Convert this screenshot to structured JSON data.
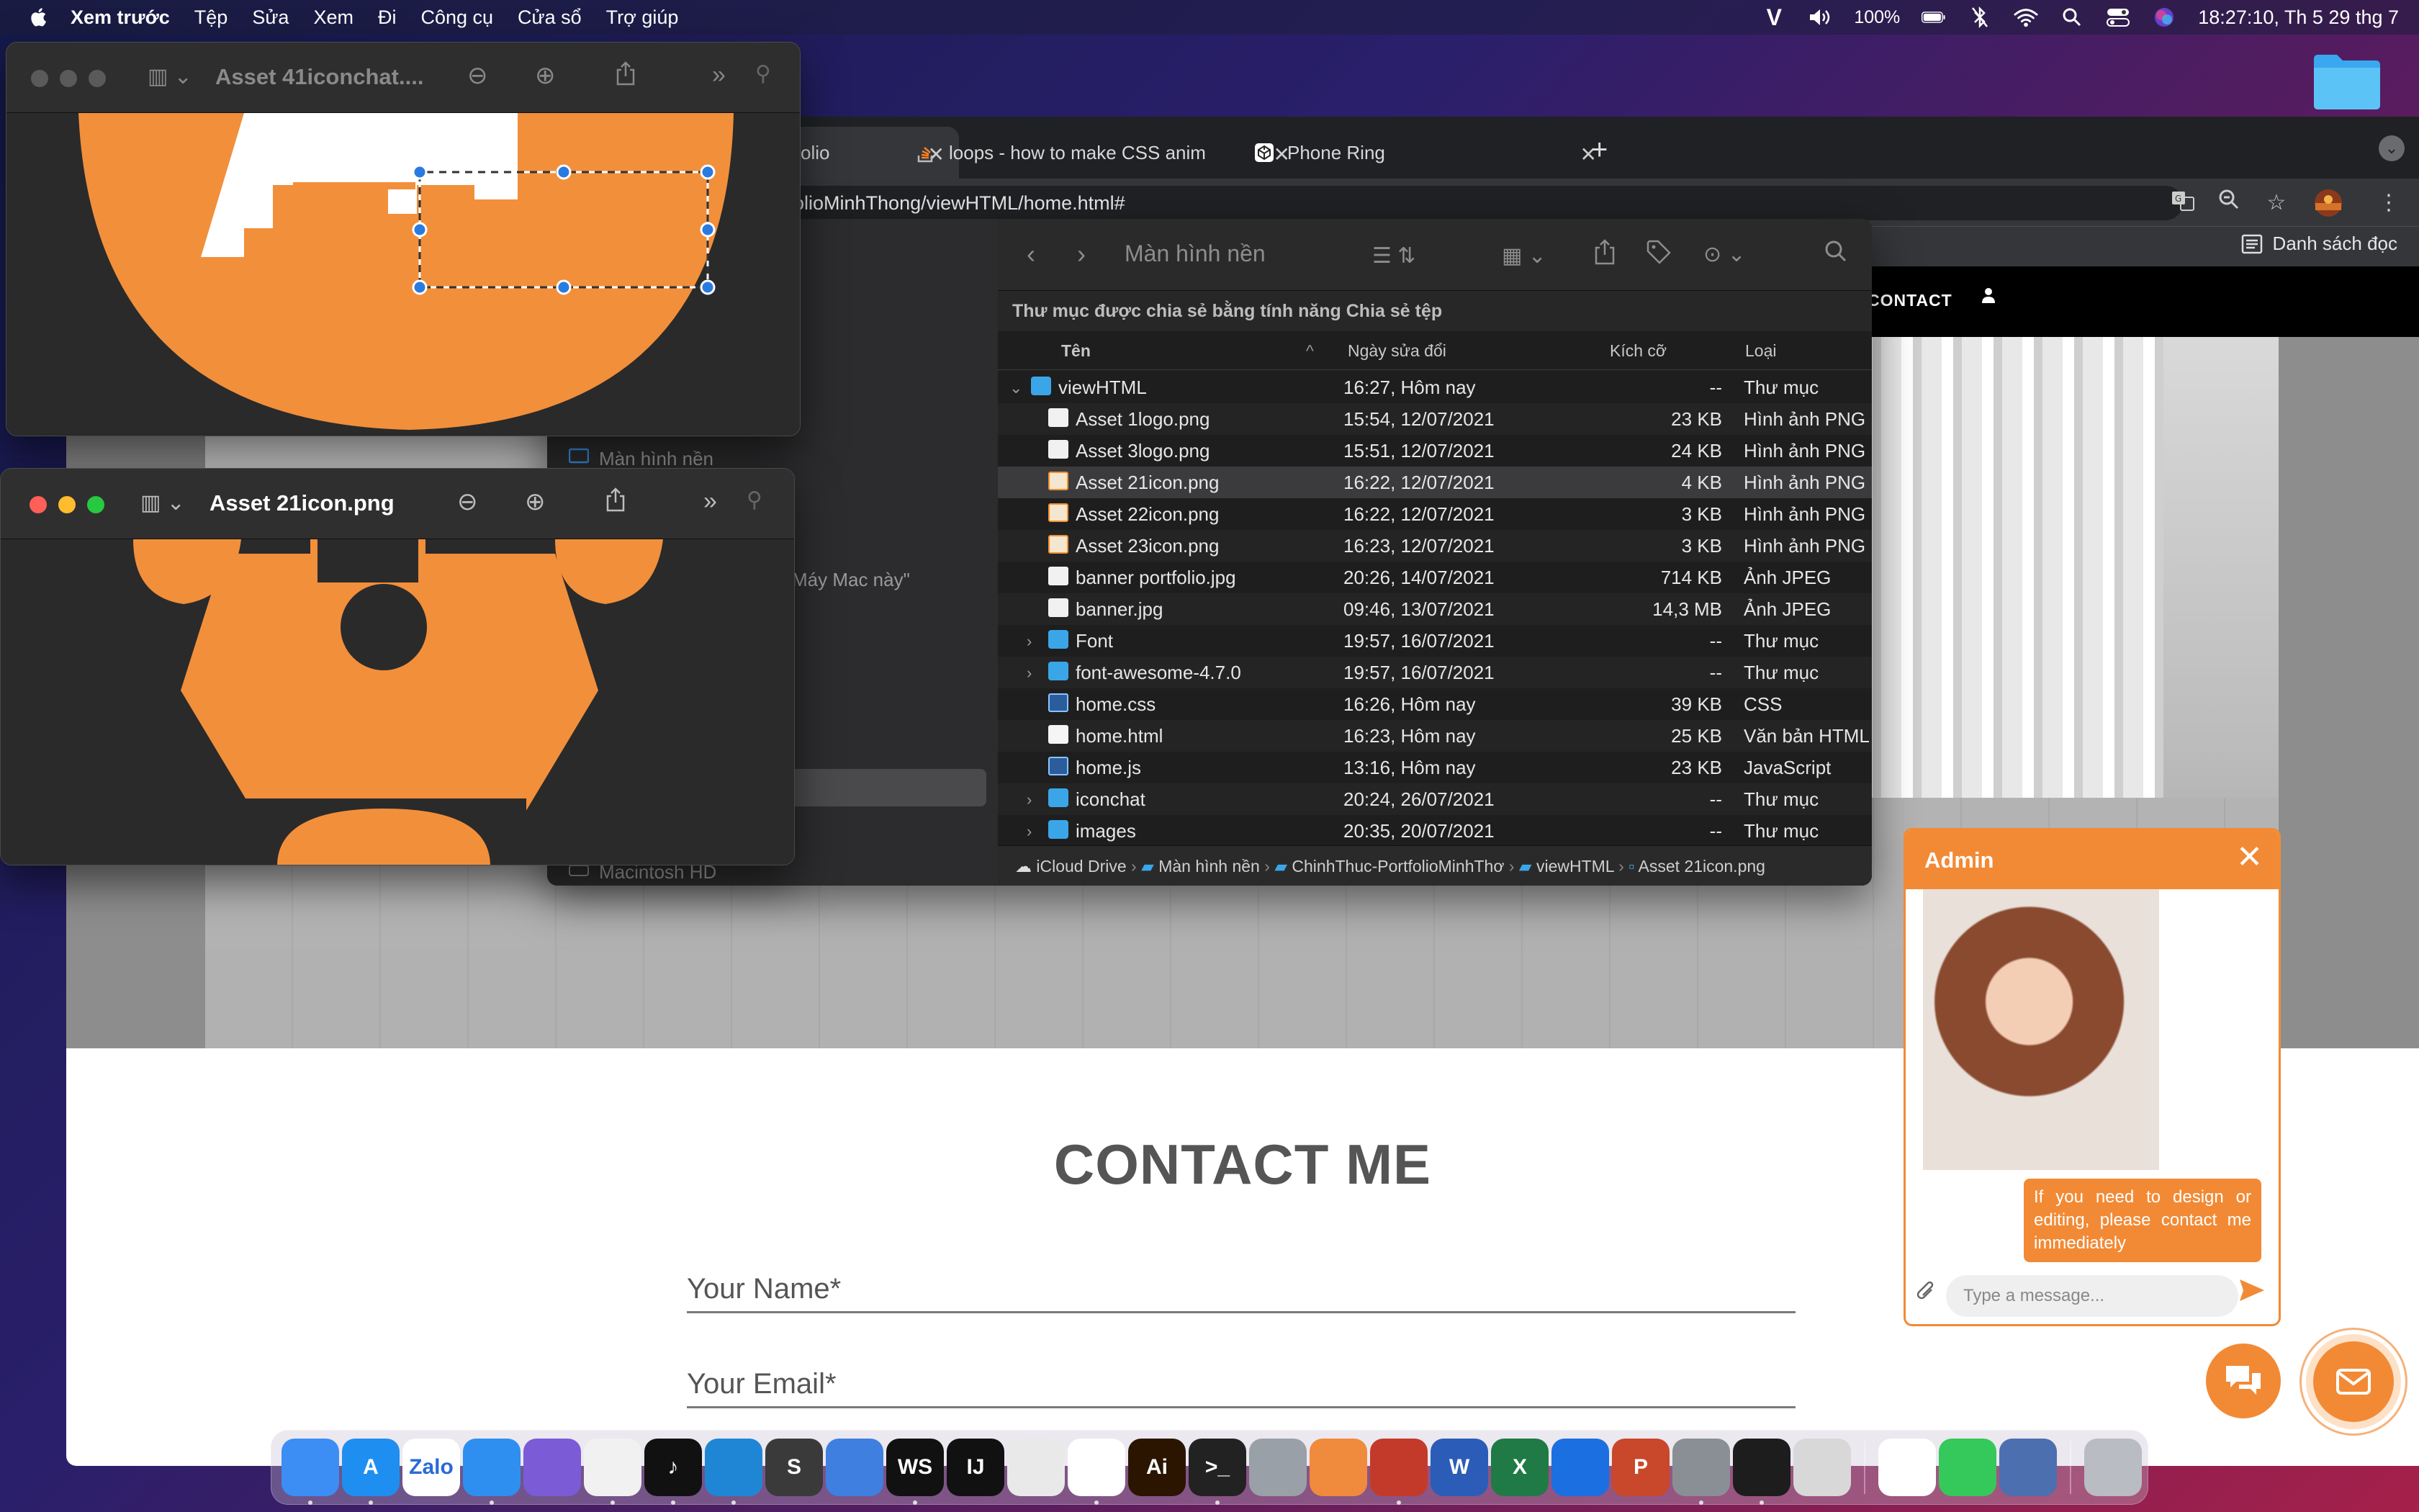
{
  "menubar": {
    "app_name": "Xem trước",
    "items": [
      "Tệp",
      "Sửa",
      "Xem",
      "Đi",
      "Công cụ",
      "Cửa sổ",
      "Trợ giúp"
    ],
    "battery": "100%",
    "clock": "18:27:10, Th 5 29 thg 7"
  },
  "chrome": {
    "tabs": [
      {
        "title": "olio",
        "icon": "portfolio-favicon"
      },
      {
        "title": "loops - how to make CSS anim",
        "icon": "stackoverflow-favicon"
      },
      {
        "title": "Phone Ring",
        "icon": "codepen-favicon"
      }
    ],
    "address": "olioMinhThong/viewHTML/home.html#",
    "reading_list": "Danh sách đọc"
  },
  "website": {
    "nav_contact": "CONTACT",
    "contact_title": "CONTACT ME",
    "name_placeholder": "Your Name*",
    "email_placeholder": "Your Email*"
  },
  "finder": {
    "title": "Màn hình nền",
    "share_banner": "Thư mục được chia sẻ bằng tính năng Chia sẻ tệp",
    "sidebar": {
      "desktop": "Màn hình nền",
      "mac": "Máy Mac này\"",
      "hd": "Macintosh HD"
    },
    "columns": {
      "name": "Tên",
      "date": "Ngày sửa đổi",
      "size": "Kích cỡ",
      "kind": "Loại"
    },
    "rows": [
      {
        "name": "viewHTML",
        "date": "16:27, Hôm nay",
        "size": "--",
        "kind": "Thư mục",
        "icon": "folder",
        "indent": 0,
        "disclosure": "⌄"
      },
      {
        "name": "Asset 1logo.png",
        "date": "15:54, 12/07/2021",
        "size": "23 KB",
        "kind": "Hình ảnh PNG",
        "icon": "img",
        "indent": 1,
        "disclosure": ""
      },
      {
        "name": "Asset 3logo.png",
        "date": "15:51, 12/07/2021",
        "size": "24 KB",
        "kind": "Hình ảnh PNG",
        "icon": "img",
        "indent": 1,
        "disclosure": ""
      },
      {
        "name": "Asset 21icon.png",
        "date": "16:22, 12/07/2021",
        "size": "4 KB",
        "kind": "Hình ảnh PNG",
        "icon": "png",
        "indent": 1,
        "disclosure": ""
      },
      {
        "name": "Asset 22icon.png",
        "date": "16:22, 12/07/2021",
        "size": "3 KB",
        "kind": "Hình ảnh PNG",
        "icon": "png",
        "indent": 1,
        "disclosure": ""
      },
      {
        "name": "Asset 23icon.png",
        "date": "16:23, 12/07/2021",
        "size": "3 KB",
        "kind": "Hình ảnh PNG",
        "icon": "png",
        "indent": 1,
        "disclosure": ""
      },
      {
        "name": "banner portfolio.jpg",
        "date": "20:26, 14/07/2021",
        "size": "714 KB",
        "kind": "Ảnh JPEG",
        "icon": "img",
        "indent": 1,
        "disclosure": ""
      },
      {
        "name": "banner.jpg",
        "date": "09:46, 13/07/2021",
        "size": "14,3 MB",
        "kind": "Ảnh JPEG",
        "icon": "img",
        "indent": 1,
        "disclosure": ""
      },
      {
        "name": "Font",
        "date": "19:57, 16/07/2021",
        "size": "--",
        "kind": "Thư mục",
        "icon": "folder",
        "indent": 1,
        "disclosure": "›"
      },
      {
        "name": "font-awesome-4.7.0",
        "date": "19:57, 16/07/2021",
        "size": "--",
        "kind": "Thư mục",
        "icon": "folder",
        "indent": 1,
        "disclosure": "›"
      },
      {
        "name": "home.css",
        "date": "16:26, Hôm nay",
        "size": "39 KB",
        "kind": "CSS",
        "icon": "code",
        "indent": 1,
        "disclosure": ""
      },
      {
        "name": "home.html",
        "date": "16:23, Hôm nay",
        "size": "25 KB",
        "kind": "Văn bản HTML",
        "icon": "doc",
        "indent": 1,
        "disclosure": ""
      },
      {
        "name": "home.js",
        "date": "13:16, Hôm nay",
        "size": "23 KB",
        "kind": "JavaScript",
        "icon": "code",
        "indent": 1,
        "disclosure": ""
      },
      {
        "name": "iconchat",
        "date": "20:24, 26/07/2021",
        "size": "--",
        "kind": "Thư mục",
        "icon": "folder",
        "indent": 1,
        "disclosure": "›"
      },
      {
        "name": "images",
        "date": "20:35, 20/07/2021",
        "size": "--",
        "kind": "Thư mục",
        "icon": "folder",
        "indent": 1,
        "disclosure": "›"
      }
    ],
    "selected_index": 3,
    "pathbar": [
      "iCloud Drive",
      "Màn hình nền",
      "ChinhThuc-PortfolioMinhThơ",
      "viewHTML",
      "Asset 21icon.png"
    ]
  },
  "preview_back": {
    "title": "Asset 41iconchat...."
  },
  "preview_front": {
    "title": "Asset 21icon.png"
  },
  "chat": {
    "admin_name": "Admin",
    "message": "If you need to design or editing, please contact me immediately",
    "input_placeholder": "Type a message..."
  },
  "dock": {
    "apps": [
      {
        "name": "finder",
        "label": "",
        "color": "#3c8ef5"
      },
      {
        "name": "app-store",
        "label": "A",
        "color": "#1f8ef1"
      },
      {
        "name": "zalo",
        "label": "Zalo",
        "color": "#ffffff"
      },
      {
        "name": "safari",
        "label": "",
        "color": "#2f8ff0"
      },
      {
        "name": "safari-preview",
        "label": "",
        "color": "#7b5bd6"
      },
      {
        "name": "chrome",
        "label": "",
        "color": "#f1f1f1"
      },
      {
        "name": "tiktok",
        "label": "♪",
        "color": "#111111"
      },
      {
        "name": "vscode",
        "label": "",
        "color": "#1f86d6"
      },
      {
        "name": "sublime",
        "label": "S",
        "color": "#3a3a3a"
      },
      {
        "name": "xcode-tools",
        "label": "",
        "color": "#3f7fe0"
      },
      {
        "name": "webstorm",
        "label": "WS",
        "color": "#111111"
      },
      {
        "name": "intellij",
        "label": "IJ",
        "color": "#111111"
      },
      {
        "name": "preview",
        "label": "",
        "color": "#e9e9e9"
      },
      {
        "name": "mongodb",
        "label": "",
        "color": "#ffffff"
      },
      {
        "name": "illustrator",
        "label": "Ai",
        "color": "#2b1500"
      },
      {
        "name": "terminal",
        "label": ">_",
        "color": "#222222"
      },
      {
        "name": "system-prefs",
        "label": "",
        "color": "#9aa0a8"
      },
      {
        "name": "pen-app",
        "label": "",
        "color": "#f08a3c"
      },
      {
        "name": "compass-app",
        "label": "",
        "color": "#c43a2a"
      },
      {
        "name": "word",
        "label": "W",
        "color": "#2b5db8"
      },
      {
        "name": "excel",
        "label": "X",
        "color": "#1f7a45"
      },
      {
        "name": "teamviewer",
        "label": "",
        "color": "#1c6fe0"
      },
      {
        "name": "powerpoint",
        "label": "P",
        "color": "#c9472b"
      },
      {
        "name": "settings",
        "label": "",
        "color": "#8a8f96"
      },
      {
        "name": "activity-monitor",
        "label": "",
        "color": "#1d1d1d"
      },
      {
        "name": "launchpad",
        "label": "",
        "color": "#d8d8d8"
      },
      {
        "name": "photos",
        "label": "",
        "color": "#ffffff"
      },
      {
        "name": "messages",
        "label": "",
        "color": "#35c85a"
      },
      {
        "name": "desktop-stack",
        "label": "",
        "color": "#4c6fb0"
      },
      {
        "name": "trash",
        "label": "",
        "color": "#b9bcc2"
      }
    ]
  }
}
